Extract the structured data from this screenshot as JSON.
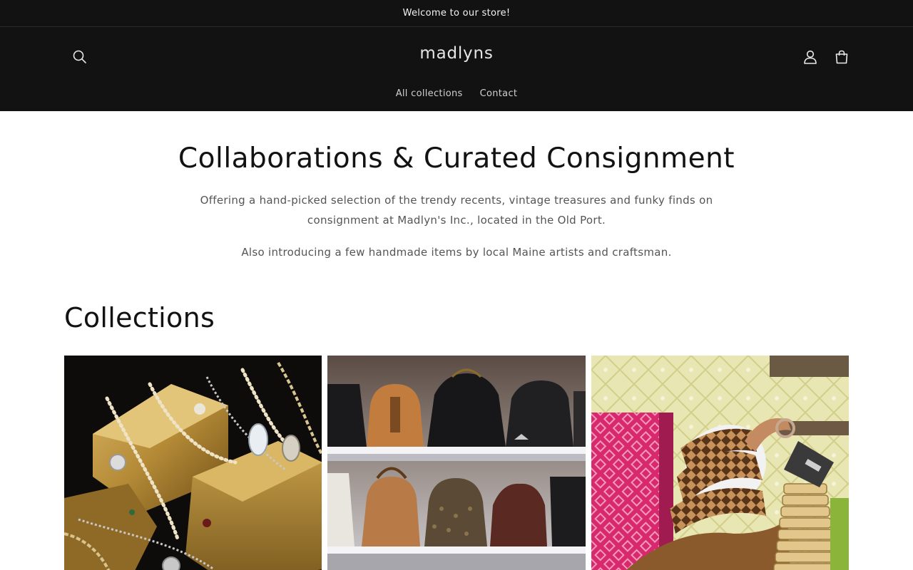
{
  "announcement": {
    "text": "Welcome to our store!"
  },
  "header": {
    "logo": "madlyns",
    "icons": {
      "search": "search-icon",
      "account": "account-icon",
      "cart": "cart-icon"
    },
    "nav": [
      {
        "label": "All collections"
      },
      {
        "label": "Contact"
      }
    ]
  },
  "intro": {
    "title": "Collaborations & Curated Consignment",
    "paragraph1": "Offering a hand-picked selection of the trendy recents, vintage treasures and funky finds on consignment at Madlyn's Inc., located in the Old Port.",
    "paragraph2": "Also introducing a few handmade items by local Maine artists and craftsman."
  },
  "collections": {
    "heading": "Collections",
    "cards": [
      {
        "image": "jewelry-image"
      },
      {
        "image": "handbags-image"
      },
      {
        "image": "shoes-image"
      }
    ]
  },
  "colors": {
    "header_bg": "#121212",
    "text": "#121212",
    "muted_text": "#555555"
  }
}
